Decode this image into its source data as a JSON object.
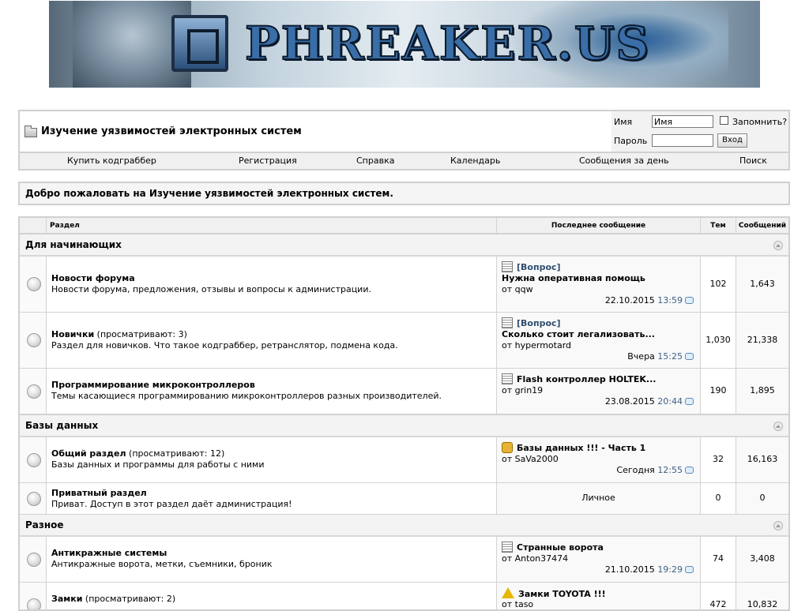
{
  "banner": {
    "logo_text": "PHREAKER.US"
  },
  "header": {
    "forum_title": "Изучение уязвимостей электронных систем",
    "login": {
      "username_label": "Имя",
      "username_value": "Имя",
      "remember_label": "Запомнить?",
      "password_label": "Пароль",
      "login_button": "Вход"
    }
  },
  "navbar": {
    "items": [
      "Купить кодграббер",
      "Регистрация",
      "Справка",
      "Календарь",
      "Сообщения за день",
      "Поиск"
    ]
  },
  "welcome": "Добро пожаловать на Изучение уязвимостей электронных систем.",
  "table": {
    "headers": {
      "forum": "Раздел",
      "last_post": "Последнее сообщение",
      "threads": "Тем",
      "posts": "Сообщений"
    }
  },
  "categories": [
    {
      "name": "Для начинающих",
      "forums": [
        {
          "title": "Новости форума",
          "viewing": "",
          "description": "Новости форума, предложения, отзывы и вопросы к администрации.",
          "last_post": {
            "icon": "post-icon",
            "prefix": "[Вопрос]",
            "title": "Нужна оперативная помощь",
            "by": "от qqw",
            "date": "22.10.2015",
            "time": "13:59"
          },
          "threads": "102",
          "posts": "1,643"
        },
        {
          "title": "Новички",
          "viewing": "(просматривают: 3)",
          "description": "Раздел для новичков. Что такое кодграббер, ретранслятор, подмена кода.",
          "last_post": {
            "icon": "post-icon",
            "prefix": "[Вопрос]",
            "title": "Сколько стоит легализовать...",
            "by": "от hypermotard",
            "date": "Вчера",
            "time": "15:25"
          },
          "threads": "1,030",
          "posts": "21,338"
        },
        {
          "title": "Программирование микроконтроллеров",
          "viewing": "",
          "description": "Темы касающиеся программированию микроконтроллеров разных производителей.",
          "last_post": {
            "icon": "post-icon",
            "prefix": "",
            "title": "Flash контроллер HOLTEK...",
            "by": "от grin19",
            "date": "23.08.2015",
            "time": "20:44"
          },
          "threads": "190",
          "posts": "1,895"
        }
      ]
    },
    {
      "name": "Базы данных",
      "forums": [
        {
          "title": "Общий раздел",
          "viewing": "(просматривают: 12)",
          "description": "Базы данных и программы для работы с ними",
          "last_post": {
            "icon": "thumbs-up-icon",
            "prefix": "",
            "title": "Базы данных !!! - Часть 1",
            "by": "от SaVa2000",
            "date": "Сегодня",
            "time": "12:55"
          },
          "threads": "32",
          "posts": "16,163"
        },
        {
          "title": "Приватный раздел",
          "viewing": "",
          "description": "Приват. Доступ в этот раздел даёт администрация!",
          "last_post_private": "Личное",
          "threads": "0",
          "posts": "0"
        }
      ]
    },
    {
      "name": "Разное",
      "forums": [
        {
          "title": "Антикражные системы",
          "viewing": "",
          "description": "Антикражные ворота, метки, съемники, броник",
          "last_post": {
            "icon": "post-icon",
            "prefix": "",
            "title": "Странные ворота",
            "by": "от Anton37474",
            "date": "21.10.2015",
            "time": "19:29"
          },
          "threads": "74",
          "posts": "3,408"
        },
        {
          "title": "Замки",
          "viewing": "(просматривают: 2)",
          "description": "",
          "last_post": {
            "icon": "warning-icon",
            "prefix": "",
            "title": "Замки TOYOTA !!!",
            "by": "от taso",
            "date": "",
            "time": ""
          },
          "threads": "472",
          "posts": "10,832"
        }
      ]
    }
  ]
}
